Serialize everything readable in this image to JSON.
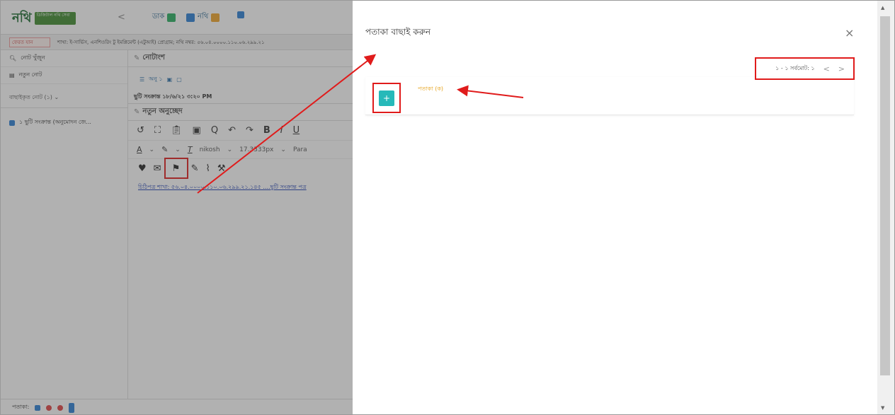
{
  "app": {
    "logo_text": "নথি",
    "logo_badge": "ডিজিটাল নথি সেবা",
    "back": "<",
    "top_items": [
      {
        "label": "ডাক",
        "color": "#27ae60"
      },
      {
        "label": "নথি",
        "color": "#f0a428"
      },
      {
        "label": "",
        "color": "#2a7fd4"
      }
    ],
    "notice_back": "ফেরত যান",
    "notice_text": "শাখা: ই-সার্ভিস, এনশিওরিং টু ইমপ্লিমেন্ট (এটুআই) প্রোগ্রাম; নথি নম্বর: ৫৬.০৪.০০০০.১১০.০৬.২৯৯.২১"
  },
  "sidebar": {
    "search": "নোট খুঁজুন",
    "new_note": "নতুন নোট",
    "section": "বাছাইকৃত নোট (১) ⌄",
    "item": "১ ছুটি সংক্রান্ত (অনুমোদন জে..."
  },
  "content": {
    "noting_title": "নোটাংশ",
    "pill": "অনু ১",
    "meta": "ছুটি সংক্রান্ত ১৮/৬/২১ ৩:২০ PM",
    "new_para": "নতুন অনুচ্ছেদ",
    "font_name": "nikosh",
    "font_size": "17.3333px",
    "para": "Para",
    "link": "চিঠিপত্র শাখা: ৫৬.০৪.০০০০.১১০.০৬.২৯৯.২১.১৪৫ ....ছুটি সংক্রান্ত পত্র"
  },
  "statusbar": {
    "label": "পতাকা:"
  },
  "panel": {
    "title": "পতাকা বাছাই করুন",
    "close": "×",
    "pager_text": "১ - ১ সর্বমোট: ১",
    "prev": "<",
    "next": ">",
    "flag_label": "পতাকা (ক)"
  },
  "colors": {
    "accent_red": "#e01b1b",
    "flag_teal": "#26b9b9",
    "flag_label": "#e5a21a"
  }
}
